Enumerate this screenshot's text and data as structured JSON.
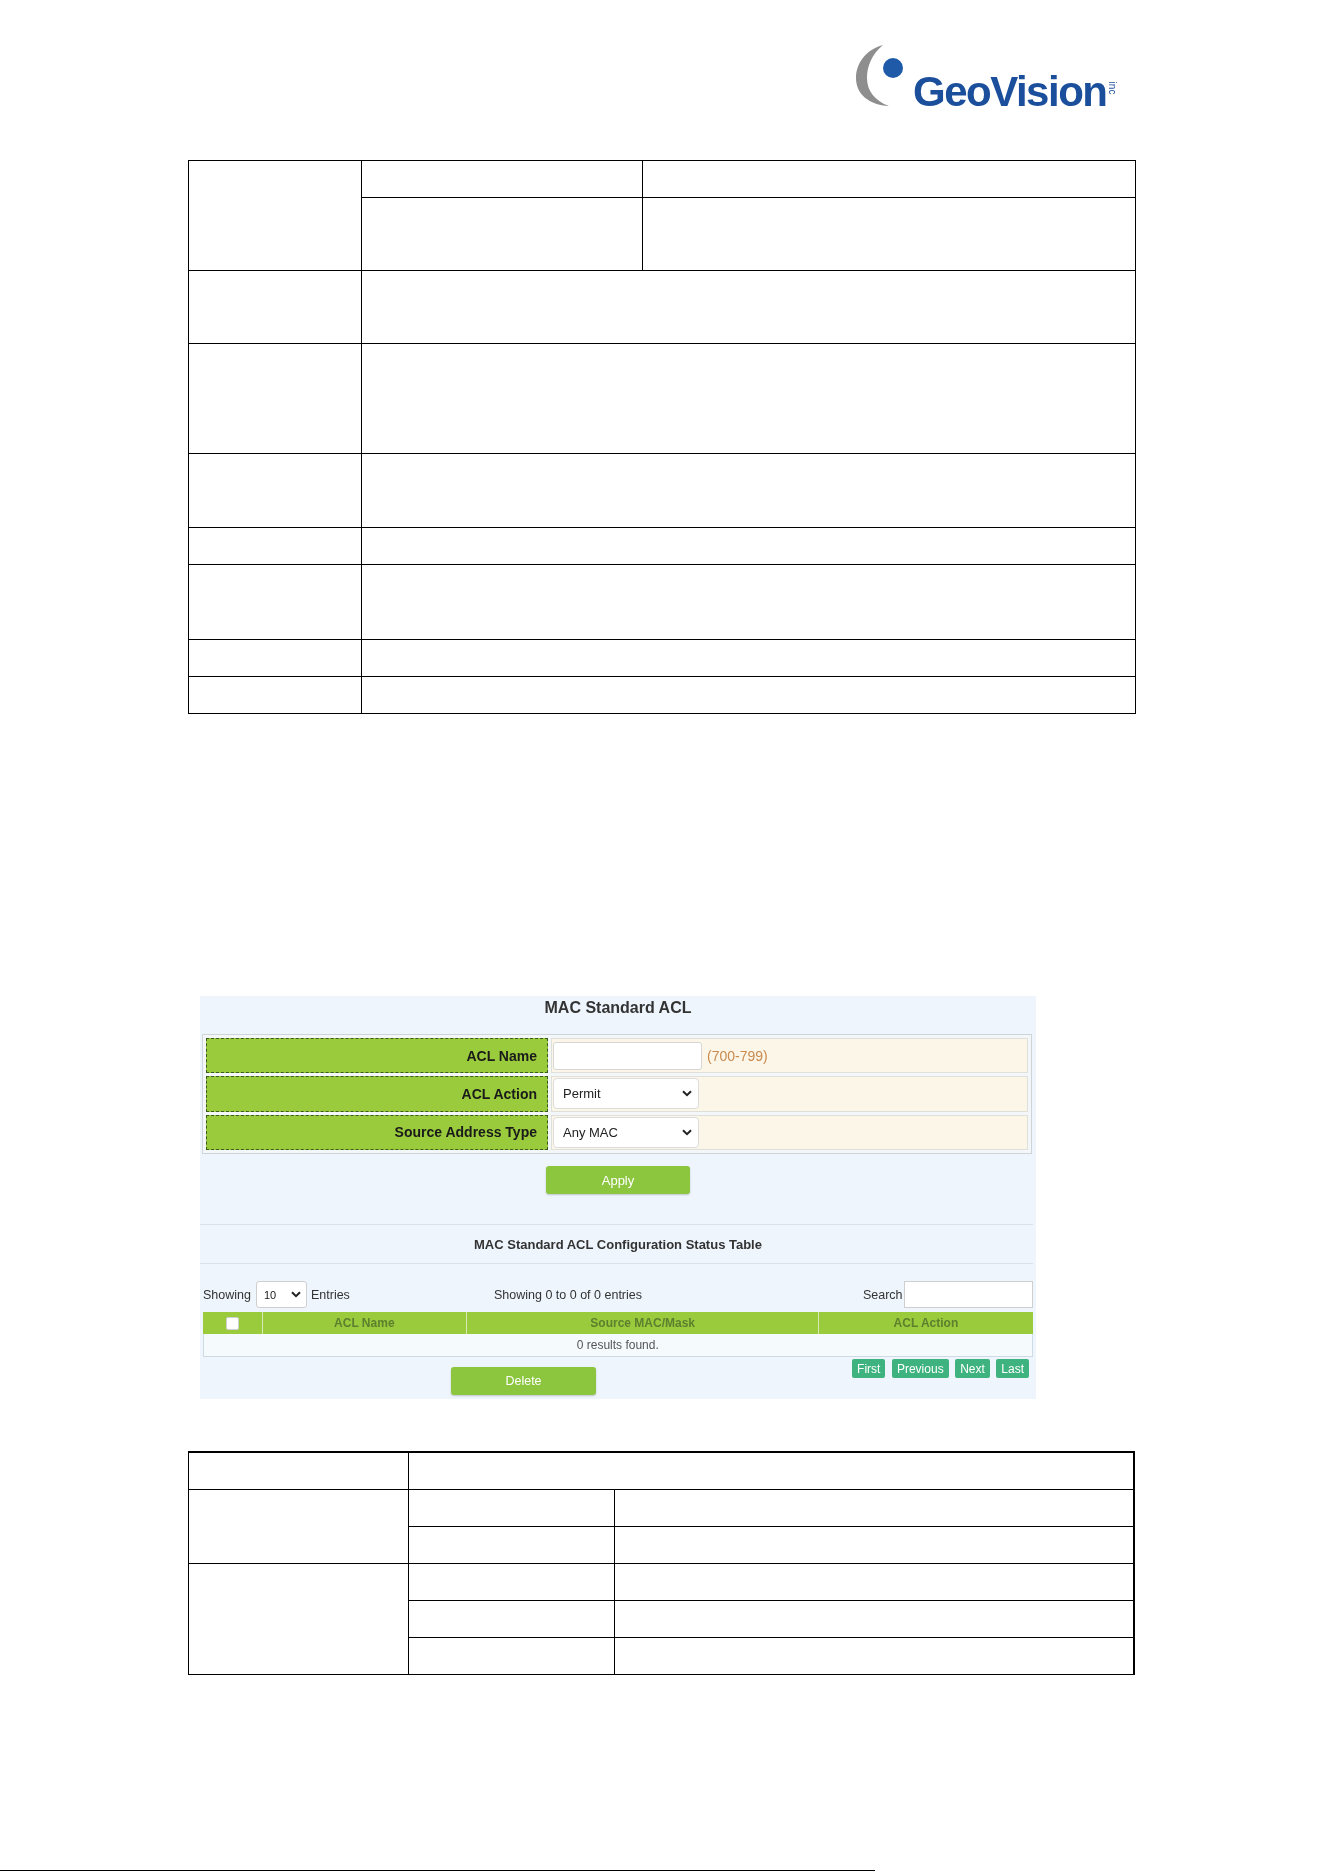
{
  "logo": {
    "wordmark": "GeoVision",
    "suffix": "inc"
  },
  "panel": {
    "title": "MAC Standard ACL",
    "fields": [
      {
        "kind": "text",
        "label": "ACL Name",
        "note": "(700-799)"
      },
      {
        "kind": "select",
        "label": "ACL Action",
        "value": "Permit"
      },
      {
        "kind": "select",
        "label": "Source Address Type",
        "value": "Any MAC"
      }
    ],
    "apply_button": "Apply",
    "status_table": {
      "title": "MAC Standard ACL Configuration Status Table",
      "length_label": "Showing",
      "length_value": "10",
      "length_suffix": "Entries",
      "summary": "Showing 0 to 0 of 0 entries",
      "search_label": "Search",
      "select_all": {
        "checked": false
      },
      "columns": [
        "ACL Name",
        "Source MAC/Mask",
        "ACL Action"
      ],
      "empty_message": "0 results found.",
      "pager": [
        "First",
        "Previous",
        "Next",
        "Last"
      ],
      "delete_button": "Delete"
    }
  }
}
